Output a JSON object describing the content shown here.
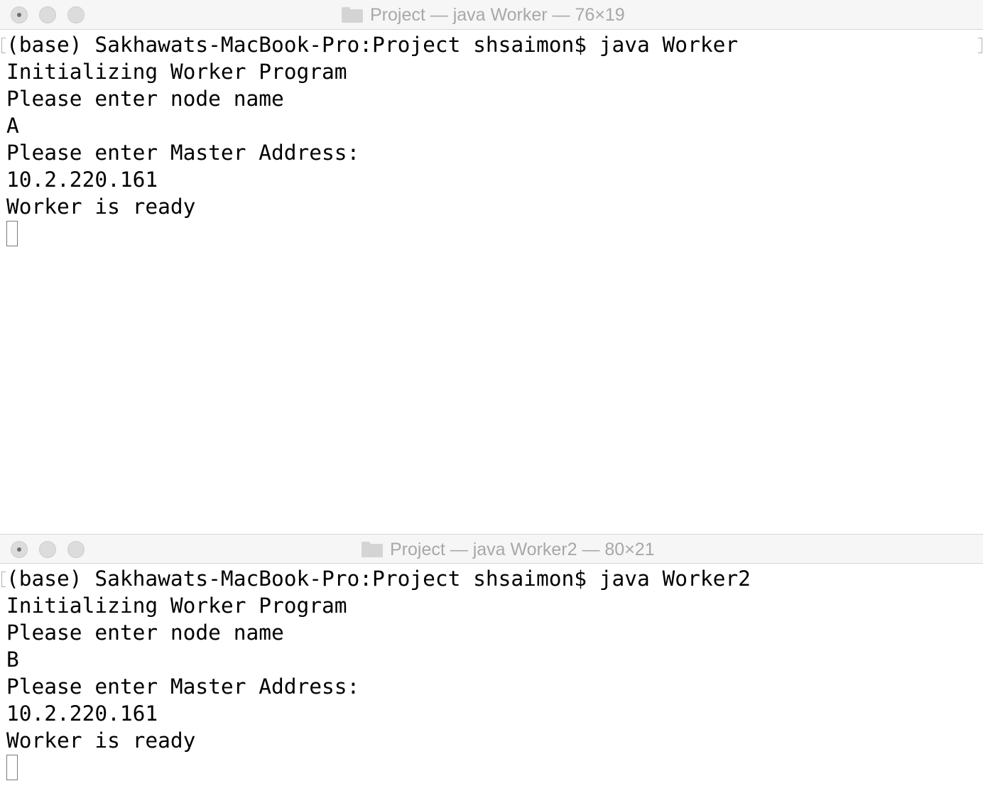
{
  "windows": [
    {
      "title": "Project — java Worker — 76×19",
      "lines": [
        "(base) Sakhawats-MacBook-Pro:Project shsaimon$ java Worker",
        "Initializing Worker Program",
        "Please enter node name",
        "A",
        "Please enter Master Address:",
        "10.2.220.161",
        "Worker is ready"
      ]
    },
    {
      "title": "Project — java Worker2 — 80×21",
      "lines": [
        "(base) Sakhawats-MacBook-Pro:Project shsaimon$ java Worker2",
        "Initializing Worker Program",
        "Please enter node name",
        "B",
        "Please enter Master Address:",
        "10.2.220.161",
        "Worker is ready"
      ]
    }
  ],
  "icons": {
    "title_icon": "folder-icon",
    "close": "close-button",
    "minimize": "minimize-button",
    "zoom": "zoom-button"
  }
}
